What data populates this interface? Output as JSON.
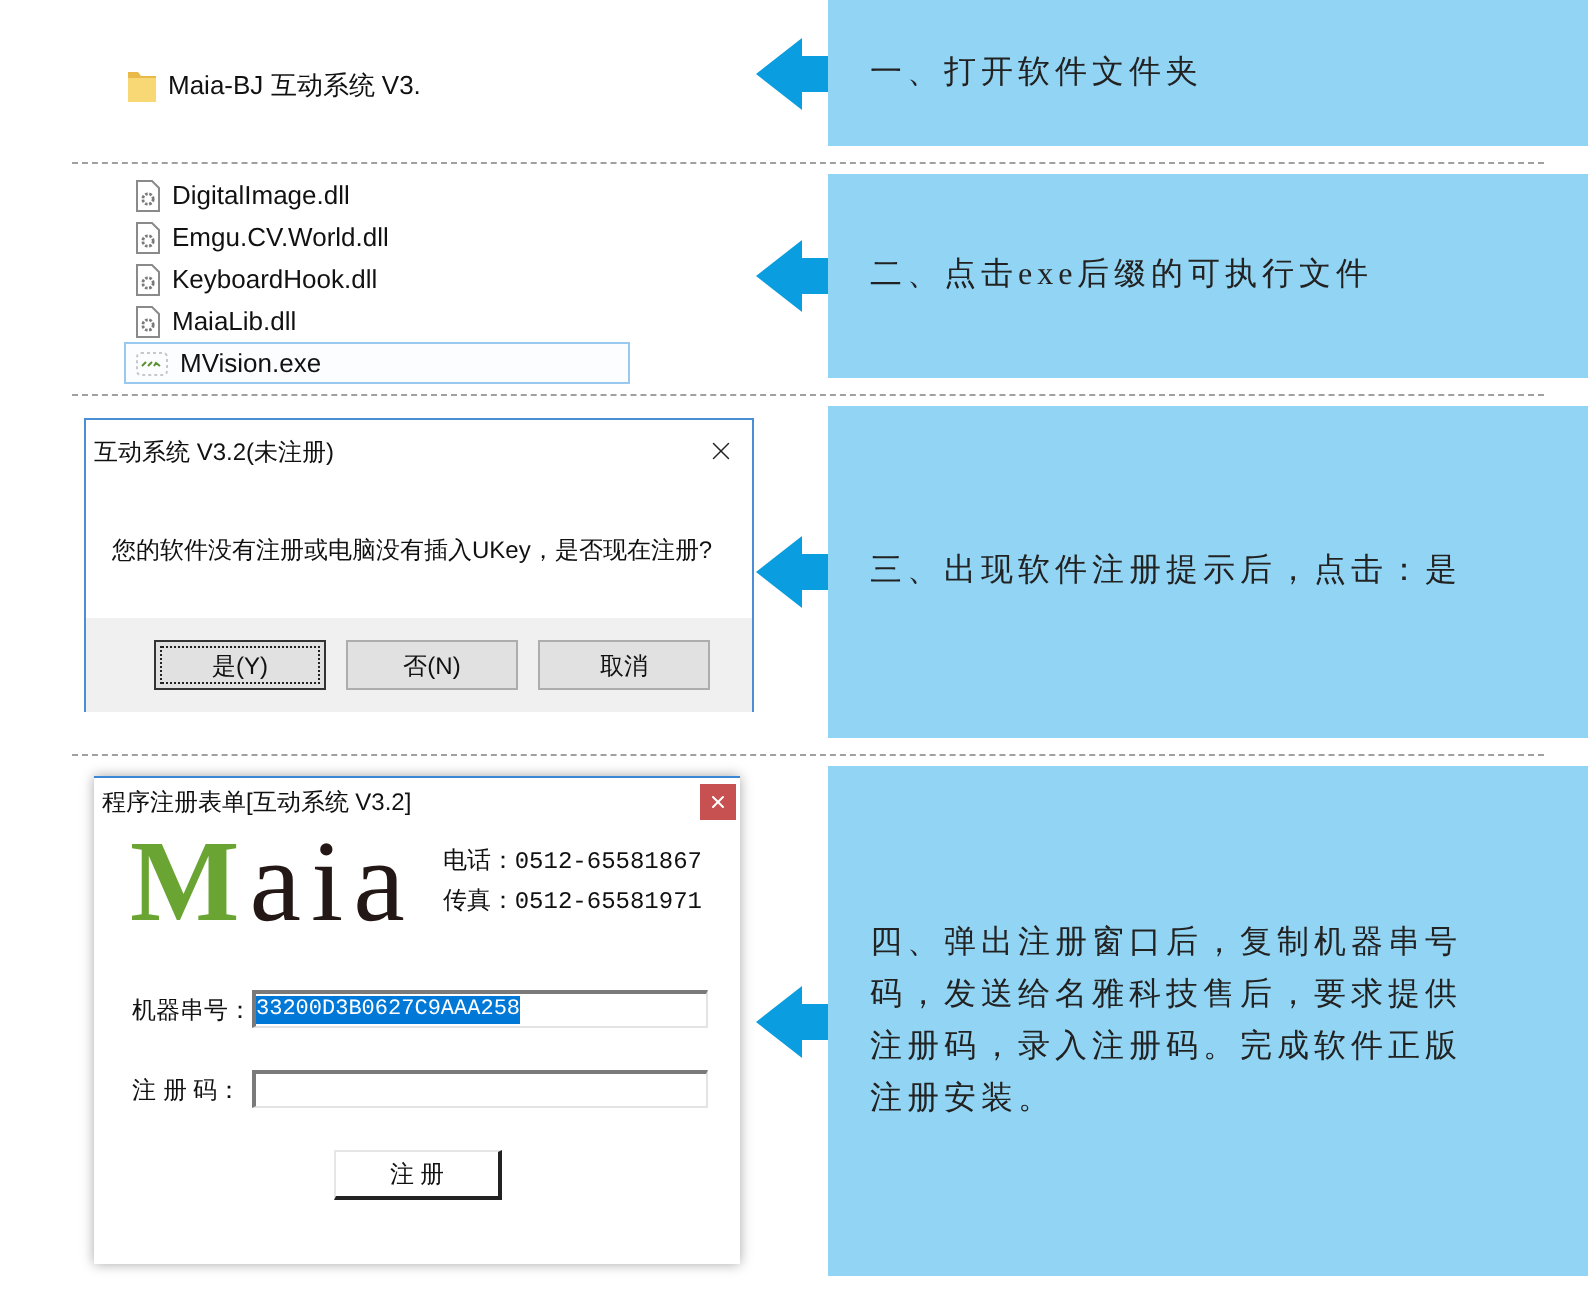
{
  "steps": [
    {
      "kind": "folder",
      "folder_name": "Maia-BJ 互动系统 V3.",
      "instruction": "一、打开软件文件夹"
    },
    {
      "kind": "file_list",
      "files": [
        {
          "name": "DigitalImage.dll",
          "kind": "library",
          "selected": false
        },
        {
          "name": "Emgu.CV.World.dll",
          "kind": "library",
          "selected": false
        },
        {
          "name": "KeyboardHook.dll",
          "kind": "library",
          "selected": false
        },
        {
          "name": "MaiaLib.dll",
          "kind": "library",
          "selected": false
        },
        {
          "name": "MVision.exe",
          "kind": "program",
          "selected": true
        }
      ],
      "instruction": "二、点击exe后缀的可执行文件"
    },
    {
      "kind": "message_box",
      "dialog": {
        "title": "互动系统 V3.2(未注册)",
        "message": "您的软件没有注册或电脑没有插入UKey，是否现在注册?",
        "buttons": [
          {
            "label": "是(Y)",
            "focused": true
          },
          {
            "label": "否(N)",
            "focused": false
          },
          {
            "label": "取消",
            "focused": false
          }
        ]
      },
      "instruction": "三、出现软件注册提示后，点击：是"
    },
    {
      "kind": "register_form",
      "dialog": {
        "title": "程序注册表单[互动系统 V3.2]",
        "logo": "Maia",
        "contacts": [
          "电话：0512-65581867",
          "传真：0512-65581971"
        ],
        "fields": [
          {
            "label": "机器串号：",
            "value": "33200D3B0627C9AAA258",
            "highlighted": true
          },
          {
            "label": "注 册 码："
          }
        ],
        "submit": "注 册"
      },
      "instruction": "四、弹出注册窗口后，复制机器串号码，发送给名雅科技售后，要求提供注册码，录入注册码。完成软件正版注册安装。"
    }
  ]
}
